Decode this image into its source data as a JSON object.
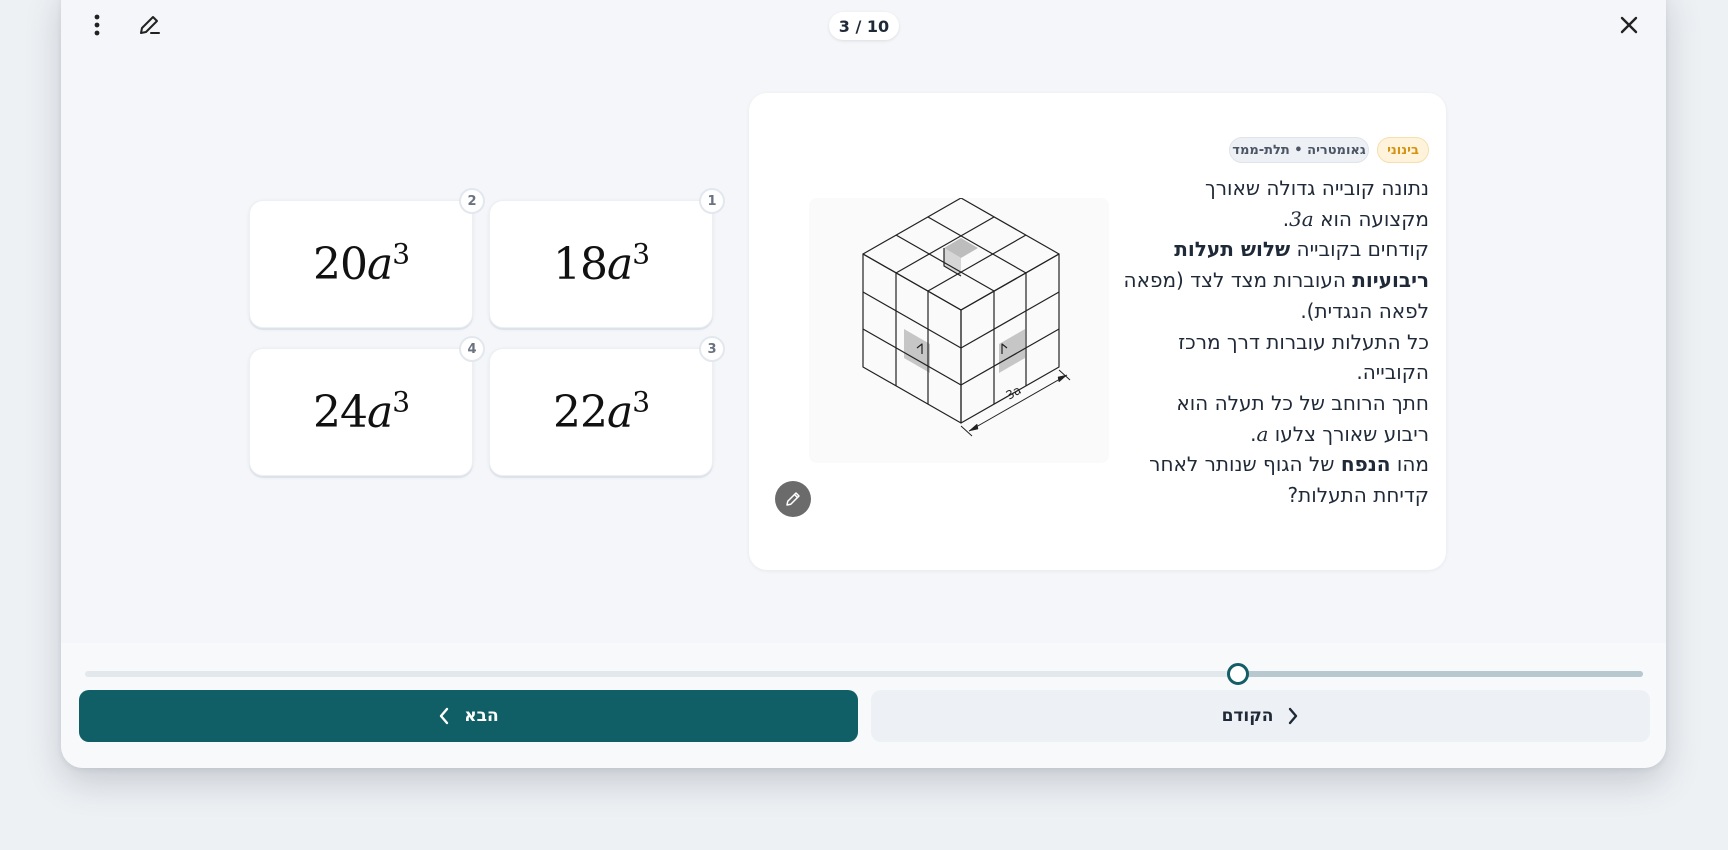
{
  "header": {
    "menu_icon": "more-vertical-icon",
    "edit_icon": "pencil-icon",
    "counter": "3 / 10",
    "close_icon": "close-icon"
  },
  "question": {
    "level_badge": "בינוני",
    "topic_badge": "גאומטריה • תלת-ממד",
    "line1": "נתונה קובייה גדולה שאורך",
    "line2_pre": "מקצועה הוא ",
    "line2_math": "3a",
    "line2_post": ".",
    "line3_pre": "קודחים בקובייה ",
    "line3_bold": "שלוש תעלות",
    "line4_bold": "ריבועיות",
    "line4_post": " העוברות מצד לצד (מפאה",
    "line5": "לפאה הנגדית).",
    "line6": "כל התעלות עוברות דרך מרכז",
    "line7": "הקובייה.",
    "line8": "חתך הרוחב של כל תעלה הוא",
    "line9_pre": "ריבוע שאורך צלעו ",
    "line9_math": "a",
    "line9_post": ".",
    "line10_pre": "מהו ",
    "line10_bold": "הנפח",
    "line10_post": " של הגוף שנותר לאחר",
    "line11": "קדיחת התעלות?",
    "figure_dim_label": "3a",
    "figure_edit_icon": "pencil-icon"
  },
  "options": [
    {
      "badge": "1",
      "coef": "18",
      "var": "a",
      "exp": "3"
    },
    {
      "badge": "2",
      "coef": "20",
      "var": "a",
      "exp": "3"
    },
    {
      "badge": "3",
      "coef": "22",
      "var": "a",
      "exp": "3"
    },
    {
      "badge": "4",
      "coef": "24",
      "var": "a",
      "exp": "3"
    }
  ],
  "progress": {
    "value": 0.74
  },
  "nav": {
    "next_label": "הבא",
    "next_icon": "chevron-left-icon",
    "prev_label": "הקודם",
    "prev_icon": "chevron-right-icon"
  },
  "colors": {
    "accent": "#105e66",
    "level_badge": "#d59312"
  }
}
